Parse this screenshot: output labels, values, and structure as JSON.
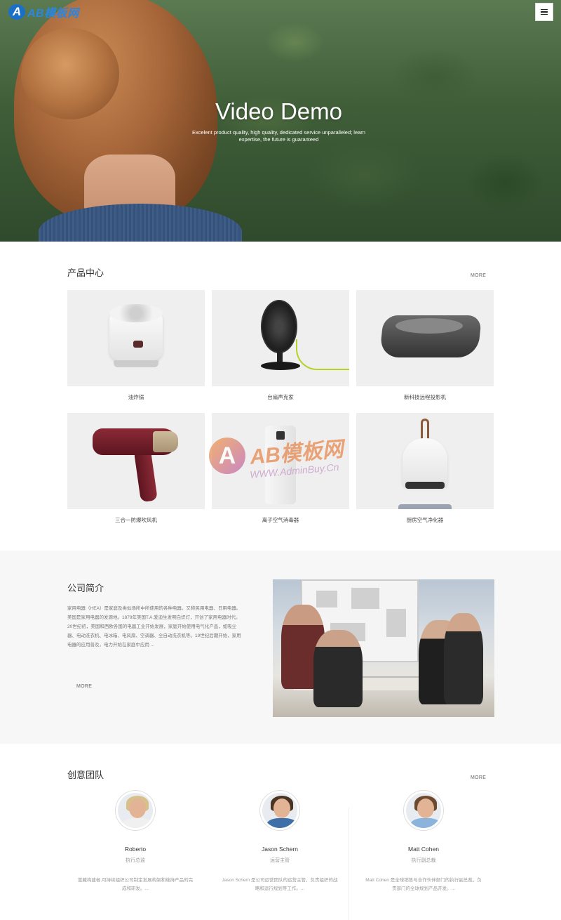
{
  "header": {
    "logo_text": "AB模板网",
    "menu_icon": "hamburger-menu-icon"
  },
  "hero": {
    "title": "Video Demo",
    "subtitle": "Excelent product quality, high quality, dedicated service unparalleled; learn expertise, the future is guaranteed"
  },
  "products": {
    "title": "产品中心",
    "more": "MORE",
    "items": [
      {
        "name": "油炸锅"
      },
      {
        "name": "台扇声克家"
      },
      {
        "name": "新科技远程投影机"
      },
      {
        "name": "三合一防爆吹风机"
      },
      {
        "name": "离子空气消毒器"
      },
      {
        "name": "厨房空气净化器"
      }
    ]
  },
  "watermark": {
    "text": "AB模板网",
    "url": "WWW.AdminBuy.Cn"
  },
  "about": {
    "title": "公司简介",
    "text": "家用电器（HEA）是家庭及类似场所中所使用的各种电器。又称民用电器、日用电器。美国是家用电器的发源地。1879年美国T.A.爱迪生发明白炽灯，开创了家用电器时代。20世纪初，美国和西欧各国的电器工业开始发展，家庭开始使用电气化产品，如吸尘器、电动洗衣机、电冰箱、电风扇、空调器、全自动洗衣机等。19世纪后期开始，家用电器的应用普及，电力开始在家庭中应用 ...",
    "more": "MORE"
  },
  "team": {
    "title": "创意团队",
    "more": "MORE",
    "members": [
      {
        "name": "Roberto",
        "role": "执行总监",
        "desc": "富藏构建者,可持续组织公司制定发展构架和维持产品的完成和研发。..."
      },
      {
        "name": "Jason Schern",
        "role": "运营主管",
        "desc": "Jason Schern 是公司运营团队的运营主管，负责组织的战略和运行规划等工作。..."
      },
      {
        "name": "Matt Cohen",
        "role": "执行副总裁",
        "desc": "Matt Cohen 是全球销售与合作伙伴部门的执行副总裁，负责部门的全球规划产品开发。..."
      }
    ]
  },
  "colors": {
    "accent_blue": "#1a6fc9",
    "about_bg": "#f7f7f7"
  }
}
